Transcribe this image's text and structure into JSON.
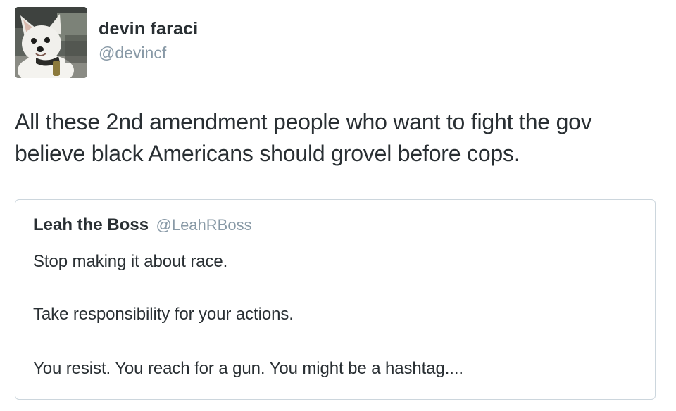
{
  "tweet": {
    "author": {
      "name": "devin faraci",
      "handle": "@devincf",
      "avatar_icon": "dog-avatar-icon"
    },
    "text": "All these 2nd amendment people who want to fight the gov believe black Americans should grovel before cops.",
    "quoted_tweet": {
      "author_name": "Leah the Boss",
      "author_handle": "@LeahRBoss",
      "lines": [
        "Stop making it about race.",
        "Take responsibility for your actions.",
        "You resist. You reach for a gun. You might be a hashtag...."
      ]
    }
  },
  "colors": {
    "text_primary": "#292f33",
    "text_secondary": "#8899a6",
    "card_border": "#ccd6dd"
  }
}
